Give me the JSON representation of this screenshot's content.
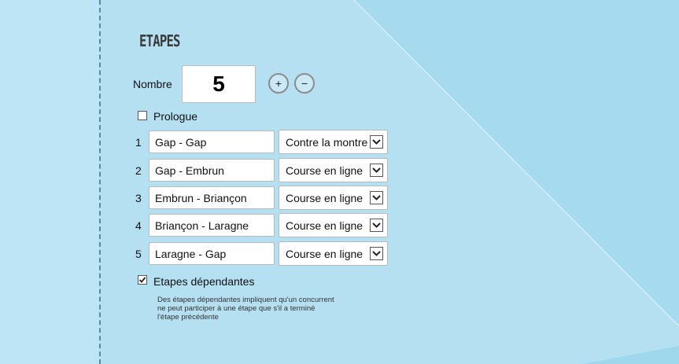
{
  "section": {
    "title": "ETAPES"
  },
  "nombre": {
    "label": "Nombre",
    "value": "5",
    "plus_label": "+",
    "minus_label": "−"
  },
  "prologue": {
    "label": "Prologue",
    "checked": false
  },
  "stages": [
    {
      "num": "1",
      "name": "Gap - Gap",
      "type": "Contre la montre"
    },
    {
      "num": "2",
      "name": "Gap - Embrun",
      "type": "Course en ligne"
    },
    {
      "num": "3",
      "name": "Embrun - Briançon",
      "type": "Course en ligne"
    },
    {
      "num": "4",
      "name": "Briançon - Laragne",
      "type": "Course en ligne"
    },
    {
      "num": "5",
      "name": "Laragne - Gap",
      "type": "Course en ligne"
    }
  ],
  "dependent": {
    "label": "Etapes dépendantes",
    "checked": true,
    "note_lines": [
      "Des étapes dépendantes impliquent qu'un concurrent",
      "ne peut participer à une étape que s'il a terminé",
      "l'étape précédente"
    ]
  }
}
